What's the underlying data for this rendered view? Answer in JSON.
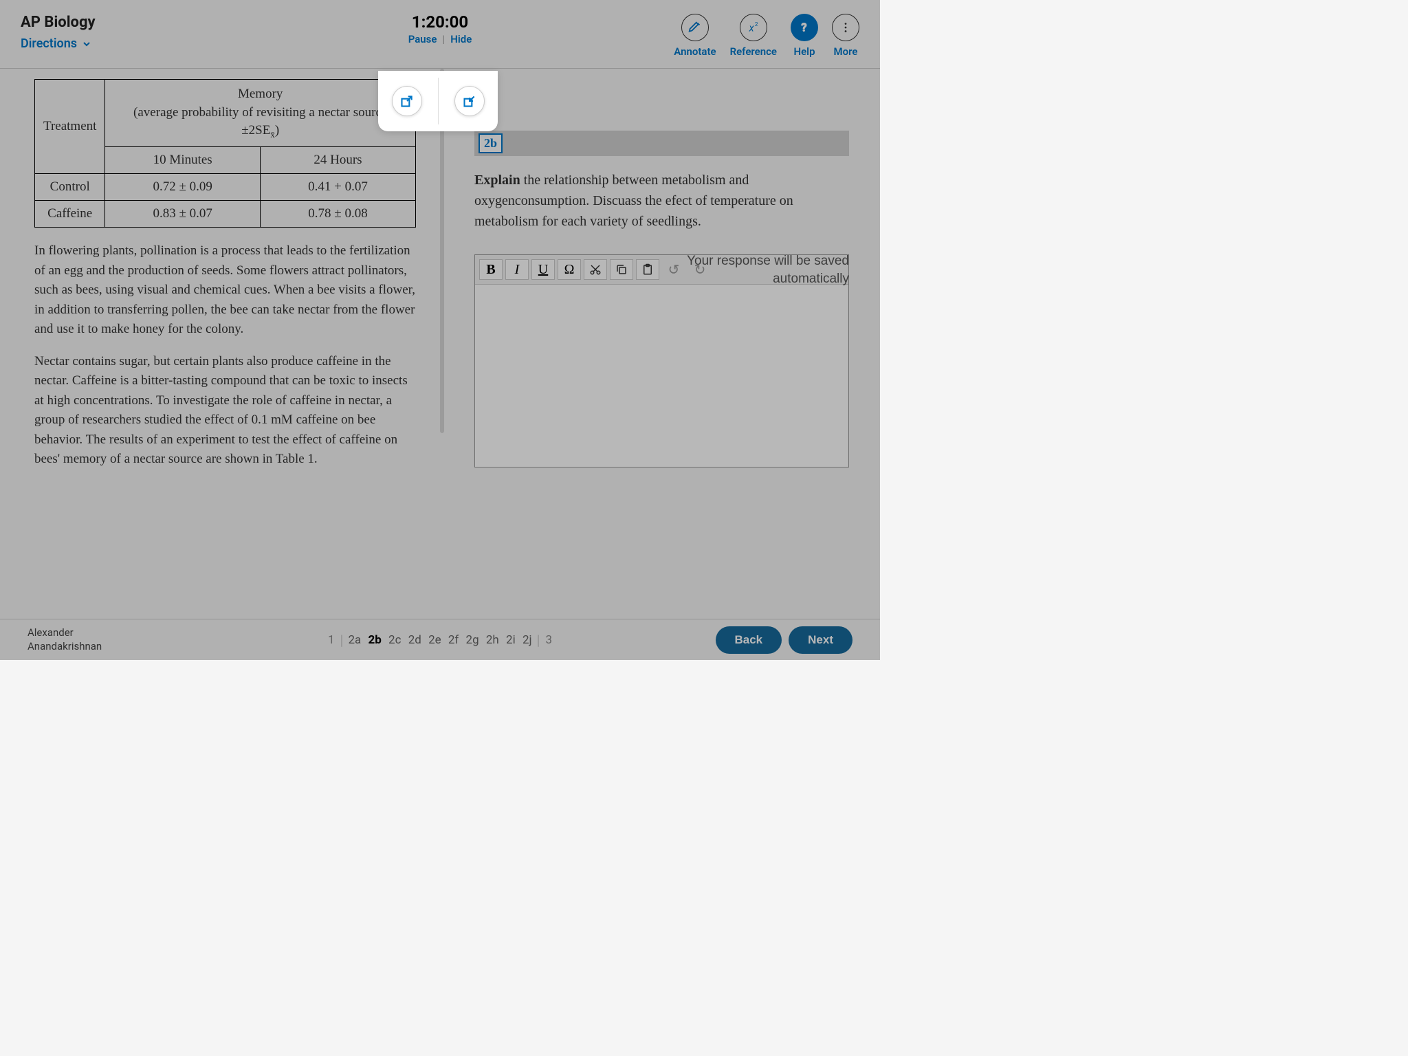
{
  "header": {
    "title": "AP Biology",
    "directions_label": "Directions",
    "timer": "1:20:00",
    "pause_label": "Pause",
    "hide_label": "Hide",
    "tools": {
      "annotate": "Annotate",
      "reference": "Reference",
      "help": "Help",
      "more": "More"
    }
  },
  "table": {
    "treatment_header": "Treatment",
    "memory_header_line1": "Memory",
    "memory_header_line2": "(average probability of revisiting a nectar source ±2SE",
    "memory_header_sub": "x̄",
    "memory_header_close": ")",
    "col1": "10 Minutes",
    "col2": "24 Hours",
    "rows": [
      {
        "label": "Control",
        "c1": "0.72 ± 0.09",
        "c2": "0.41 + 0.07"
      },
      {
        "label": "Caffeine",
        "c1": "0.83 ± 0.07",
        "c2": "0.78 ± 0.08"
      }
    ]
  },
  "passage": {
    "p1": "In flowering plants, pollination is a process that leads to the fertilization of an egg and the production of seeds. Some flowers attract pollinators, such as bees, using visual and chemical cues. When a bee visits a flower, in addition to transferring pollen, the bee can take nectar from the flower and use it to make honey for the colony.",
    "p2": "Nectar contains sugar, but certain plants also produce caffeine in the nectar. Caffeine is a bitter-tasting compound that can be toxic to insects at high concentrations. To investigate the role of caffeine in nectar, a group of researchers studied the effect of 0.1 mM caffeine on bee behavior. The results of an experiment to test the effect of caffeine on bees' memory of a nectar source are shown in Table 1."
  },
  "question": {
    "badge": "2b",
    "bold": "Explain",
    "text": " the relationship between metabolism and oxygenconsumption. Discuass the efect of temperature on metabolism for each variety of seedlings.",
    "save_note_l1": "Your response will be saved",
    "save_note_l2": "automatically"
  },
  "editor_toolbar": {
    "bold": "B",
    "italic": "I",
    "underline": "U",
    "omega": "Ω",
    "cut": "✂",
    "copy": "⿻",
    "paste": "📋",
    "undo": "↺",
    "redo": "↻"
  },
  "footer": {
    "student_first": "Alexander",
    "student_last": "Anandakrishnan",
    "pages": {
      "p1": "1",
      "subs": [
        "2a",
        "2b",
        "2c",
        "2d",
        "2e",
        "2f",
        "2g",
        "2h",
        "2i",
        "2j"
      ],
      "active": "2b",
      "p3": "3"
    },
    "back": "Back",
    "next": "Next"
  }
}
